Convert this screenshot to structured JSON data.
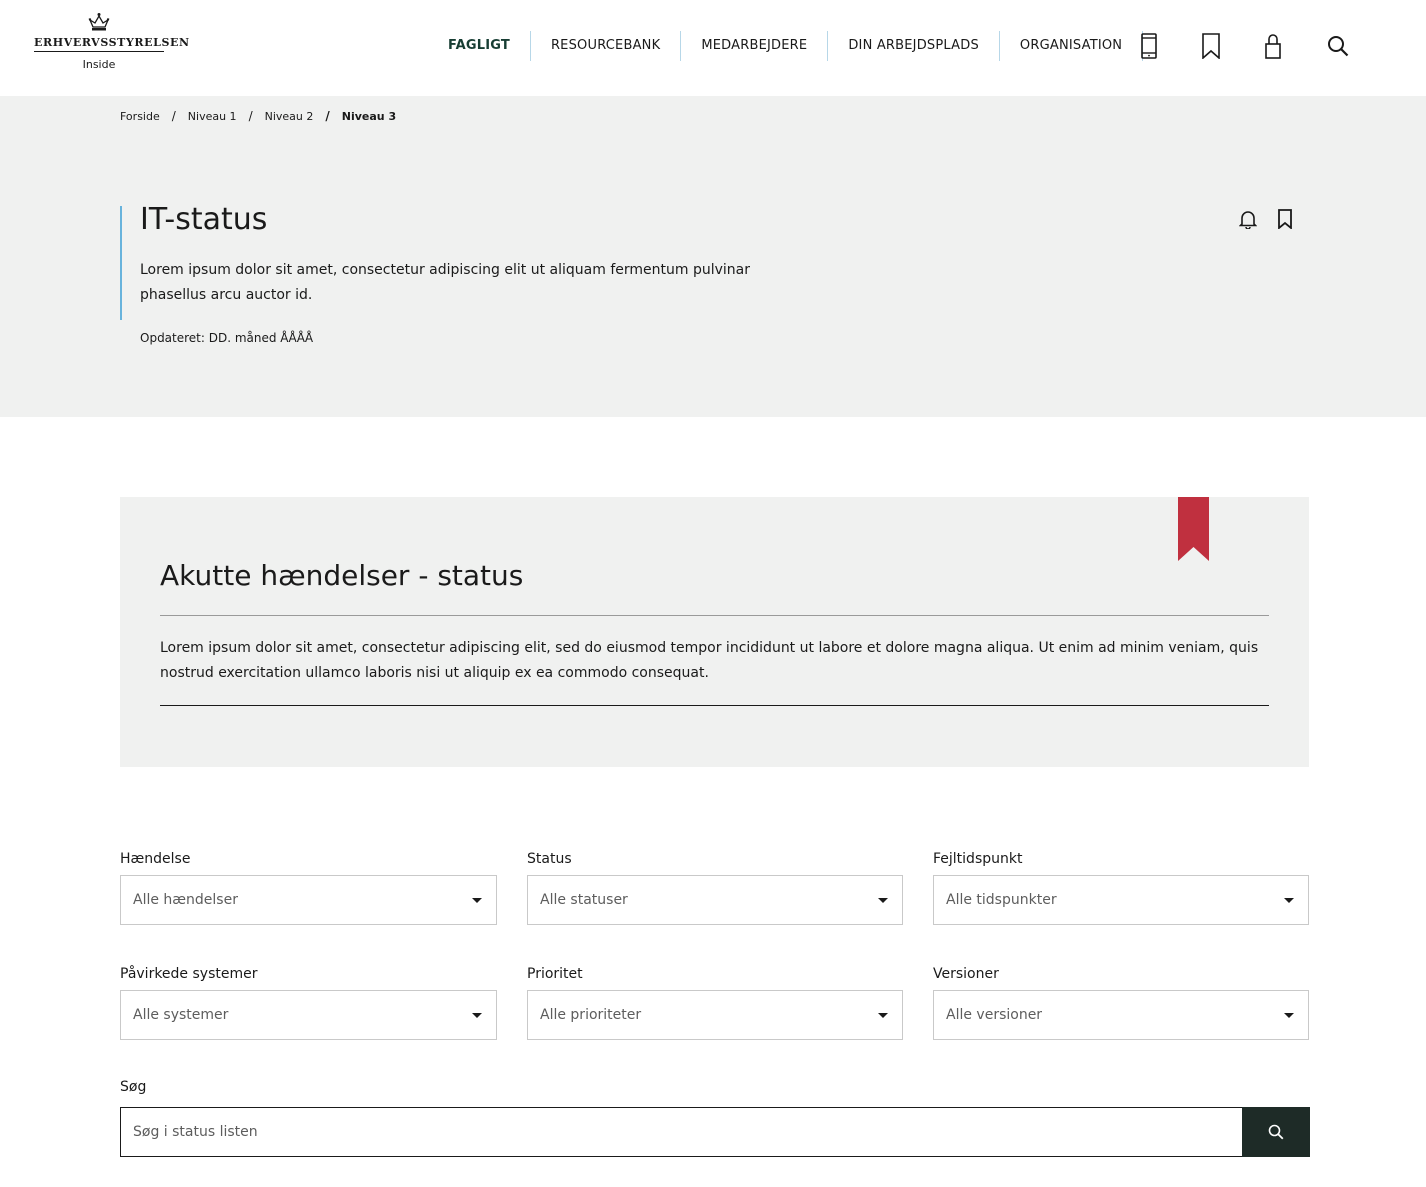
{
  "logo": {
    "wordmark": "Erhvervsstyrelsen",
    "subtitle": "Inside"
  },
  "nav": {
    "items": [
      {
        "label": "FAGLIGT"
      },
      {
        "label": "RESOURCEBANK"
      },
      {
        "label": "MEDARBEJDERE"
      },
      {
        "label": "DIN ARBEJDSPLADS"
      },
      {
        "label": "ORGANISATION"
      }
    ]
  },
  "tools": [
    "phone-icon",
    "bookmark-icon",
    "lock-icon",
    "search-icon"
  ],
  "breadcrumb": {
    "items": [
      "Forside",
      "Niveau 1",
      "Niveau 2"
    ],
    "current": "Niveau 3",
    "separator": "/"
  },
  "hero": {
    "title": "IT-status",
    "description": "Lorem ipsum dolor sit amet, consectetur adipiscing elit ut aliquam fermentum pulvinar phasellus arcu auctor id.",
    "updated": "Opdateret: DD. måned ÅÅÅÅ"
  },
  "card": {
    "title": "Akutte hændelser - status",
    "text": "Lorem ipsum dolor sit amet, consectetur adipiscing elit, sed do eiusmod tempor incididunt ut labore et dolore magna aliqua. Ut enim ad minim veniam, quis nostrud exercitation ullamco laboris nisi ut aliquip ex ea commodo consequat."
  },
  "filters": [
    {
      "label": "Hændelse",
      "value": "Alle hændelser"
    },
    {
      "label": "Status",
      "value": "Alle statuser"
    },
    {
      "label": "Fejltidspunkt",
      "value": "Alle tidspunkter"
    },
    {
      "label": "Påvirkede systemer",
      "value": "Alle systemer"
    },
    {
      "label": "Prioritet",
      "value": "Alle prioriteter"
    },
    {
      "label": "Versioner",
      "value": "Alle versioner"
    }
  ],
  "search": {
    "label": "Søg",
    "placeholder": "Søg i status listen"
  },
  "colors": {
    "accent_line": "#68b3dc",
    "ribbon": "#c0303f",
    "search_button": "#1e2b27",
    "panel_bg": "#f0f1f0"
  }
}
